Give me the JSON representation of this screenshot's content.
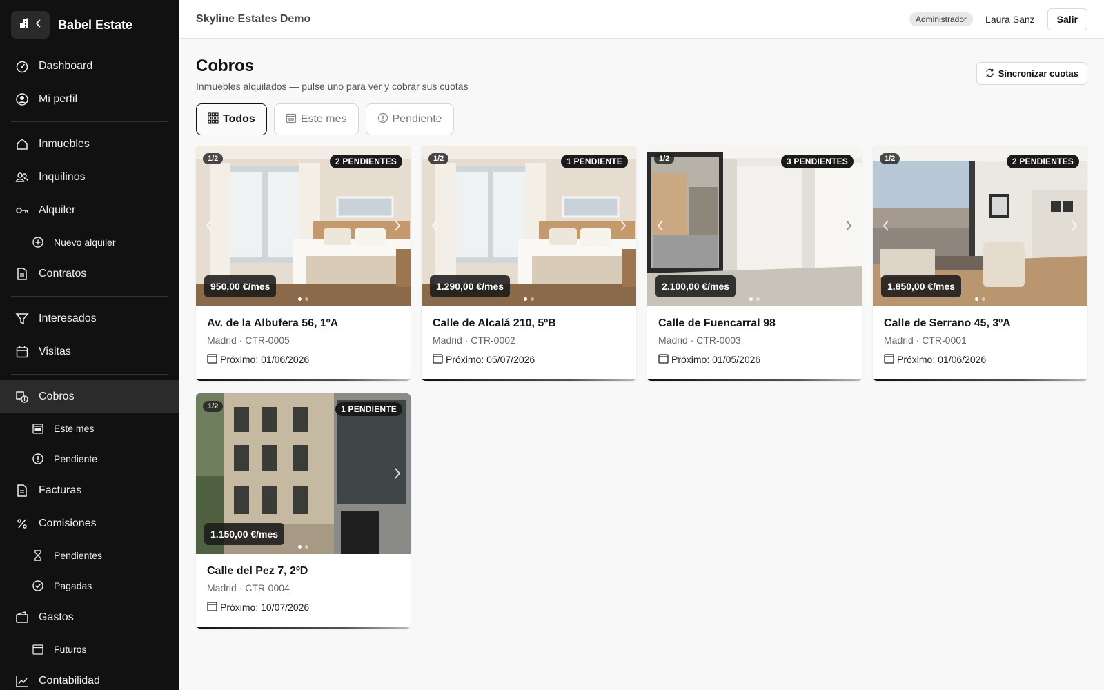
{
  "app": {
    "brand": "Babel Estate",
    "organization": "Skyline Estates Demo"
  },
  "user": {
    "role": "Administrador",
    "name": "Laura Sanz",
    "logout_label": "Salir"
  },
  "sidebar": {
    "items": [
      {
        "label": "Dashboard",
        "icon": "gauge-icon"
      },
      {
        "label": "Mi perfil",
        "icon": "user-circle-icon"
      },
      {
        "label": "Inmuebles",
        "icon": "home-icon"
      },
      {
        "label": "Inquilinos",
        "icon": "users-icon"
      },
      {
        "label": "Alquiler",
        "icon": "key-icon"
      },
      {
        "label": "Nuevo alquiler",
        "icon": "plus-circle-icon"
      },
      {
        "label": "Contratos",
        "icon": "document-icon"
      },
      {
        "label": "Interesados",
        "icon": "filter-icon"
      },
      {
        "label": "Visitas",
        "icon": "calendar-icon"
      },
      {
        "label": "Cobros",
        "icon": "payments-icon"
      },
      {
        "label": "Este mes",
        "icon": "calendar-month-icon"
      },
      {
        "label": "Pendiente",
        "icon": "alert-circle-icon"
      },
      {
        "label": "Facturas",
        "icon": "document-icon"
      },
      {
        "label": "Comisiones",
        "icon": "percent-icon"
      },
      {
        "label": "Pendientes",
        "icon": "hourglass-icon"
      },
      {
        "label": "Pagadas",
        "icon": "check-circle-icon"
      },
      {
        "label": "Gastos",
        "icon": "wallet-icon"
      },
      {
        "label": "Futuros",
        "icon": "calendar-icon"
      },
      {
        "label": "Contabilidad",
        "icon": "chart-line-icon"
      }
    ]
  },
  "page": {
    "title": "Cobros",
    "subtitle": "Inmuebles alquilados — pulse uno para ver y cobrar sus cuotas",
    "sync_label": "Sincronizar cuotas"
  },
  "filters": [
    {
      "label": "Todos",
      "icon": "grid-icon",
      "active": true
    },
    {
      "label": "Este mes",
      "icon": "calendar-month-icon",
      "active": false
    },
    {
      "label": "Pendiente",
      "icon": "alert-circle-icon",
      "active": false
    }
  ],
  "cards": [
    {
      "counter": "1/2",
      "badge": "2 PENDIENTES",
      "price": "950,00 €/mes",
      "title": "Av. de la Albufera 56, 1ºA",
      "meta": "Madrid · CTR-0005",
      "next": "Próximo: 01/06/2026",
      "scene": "bedroom"
    },
    {
      "counter": "1/2",
      "badge": "1 PENDIENTE",
      "price": "1.290,00 €/mes",
      "title": "Calle de Alcalá 210, 5ºB",
      "meta": "Madrid · CTR-0002",
      "next": "Próximo: 05/07/2026",
      "scene": "bedroom"
    },
    {
      "counter": "1/2",
      "badge": "3 PENDIENTES",
      "price": "2.100,00 €/mes",
      "title": "Calle de Fuencarral 98",
      "meta": "Madrid · CTR-0003",
      "next": "Próximo: 01/05/2026",
      "scene": "shop"
    },
    {
      "counter": "1/2",
      "badge": "2 PENDIENTES",
      "price": "1.850,00 €/mes",
      "title": "Calle de Serrano 45, 3ºA",
      "meta": "Madrid · CTR-0001",
      "next": "Próximo: 01/06/2026",
      "scene": "living"
    },
    {
      "counter": "1/2",
      "badge": "1 PENDIENTE",
      "price": "1.150,00 €/mes",
      "title": "Calle del Pez 7, 2ºD",
      "meta": "Madrid · CTR-0004",
      "next": "Próximo: 10/07/2026",
      "scene": "facade"
    }
  ]
}
